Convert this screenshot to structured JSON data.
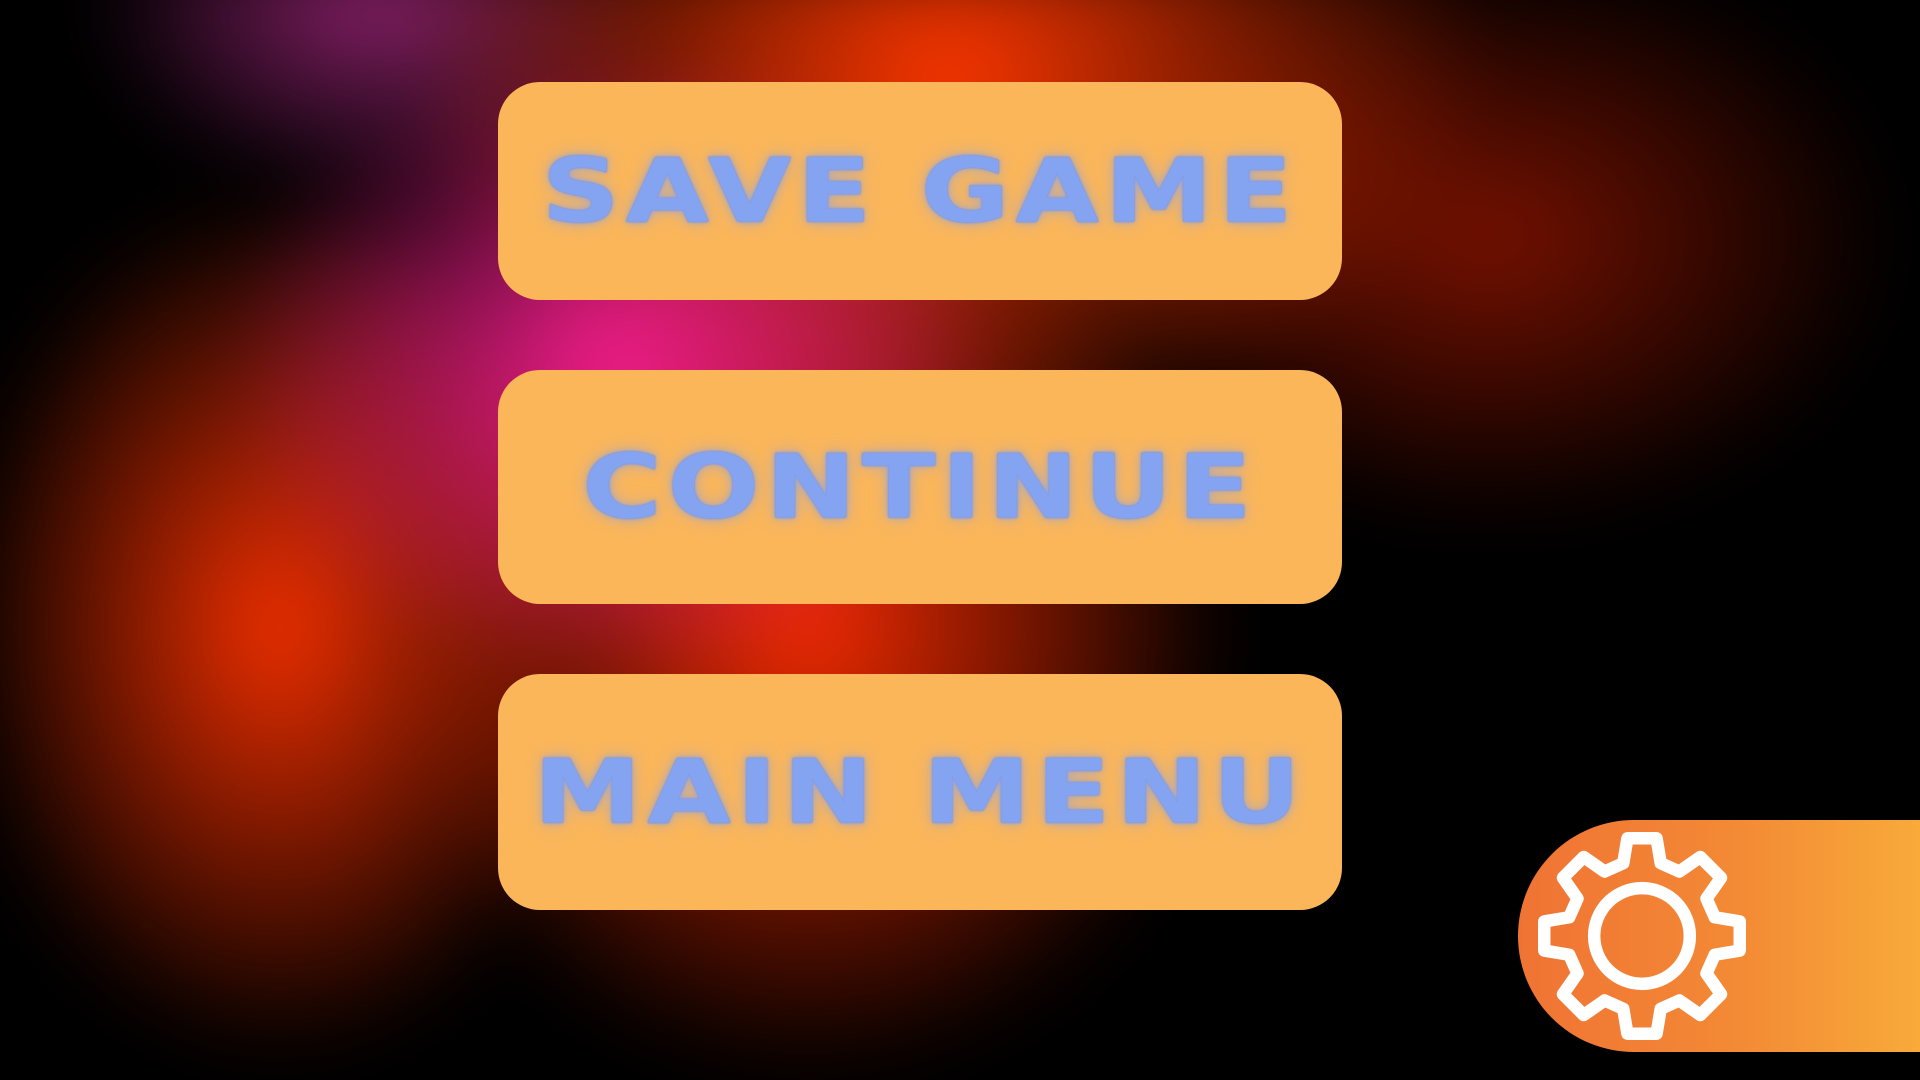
{
  "menu": {
    "save_game_label": "SAVE GAME",
    "continue_label": "CONTINUE",
    "main_menu_label": "MAIN MENU"
  },
  "settings": {
    "icon": "gear-icon"
  },
  "colors": {
    "button_fill": "#fbb65a",
    "button_text": "#84a3f0",
    "settings_tab_start": "#f07334",
    "settings_tab_end": "#f8aa3a",
    "background": "#000000"
  }
}
